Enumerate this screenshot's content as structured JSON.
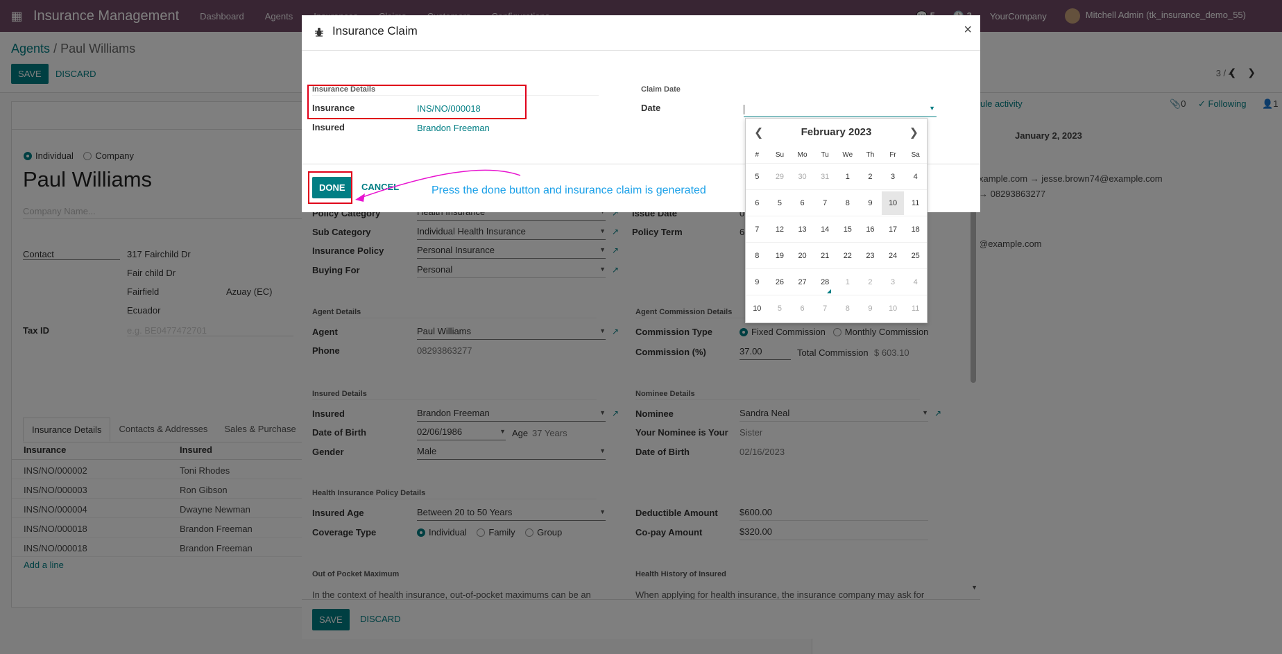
{
  "topbar": {
    "app_name": "Insurance Management",
    "menu": [
      "Dashboard",
      "Agents",
      "Insurances",
      "Claims",
      "Customers",
      "Configurations"
    ],
    "company": "YourCompany",
    "user": "Mitchell Admin (tk_insurance_demo_55)",
    "badge_messages": "5",
    "badge_activities": "3"
  },
  "control_panel": {
    "breadcrumb_parent": "Agents",
    "breadcrumb_sep": "/",
    "breadcrumb_current": "Paul Williams",
    "save": "SAVE",
    "discard": "DISCARD",
    "pager": "3 / 4"
  },
  "partner": {
    "type_individual": "Individual",
    "type_company": "Company",
    "name": "Paul Williams",
    "company_placeholder": "Company Name...",
    "address_type": "Contact",
    "street": "317 Fairchild Dr",
    "street2": "Fair child Dr",
    "city": "Fairfield",
    "state": "Azuay (EC)",
    "country": "Ecuador",
    "tax_id_label": "Tax ID",
    "tax_id_placeholder": "e.g. BE0477472701"
  },
  "notebook": {
    "tabs": [
      "Insurance Details",
      "Contacts & Addresses",
      "Sales & Purchase"
    ],
    "columns": [
      "Insurance",
      "Insured"
    ],
    "rows": [
      [
        "INS/NO/000002",
        "Toni Rhodes"
      ],
      [
        "INS/NO/000003",
        "Ron Gibson"
      ],
      [
        "INS/NO/000004",
        "Dwayne Newman"
      ],
      [
        "INS/NO/000018",
        "Brandon Freeman"
      ],
      [
        "INS/NO/000018",
        "Brandon Freeman"
      ]
    ],
    "add_line": "Add a line"
  },
  "chatter": {
    "schedule": "ule activity",
    "attachments": "0",
    "following": "Following",
    "followers": "1",
    "date_sep": "January 2, 2023",
    "line1": "xample.com → jesse.brown74@example.com",
    "line2": "→ 08293863277",
    "line3": "@example.com"
  },
  "form_back": {
    "policy_category_label": "Policy Category",
    "policy_category": "Health Insurance",
    "sub_category_label": "Sub Category",
    "sub_category": "Individual Health Insurance",
    "insurance_policy_label": "Insurance Policy",
    "insurance_policy": "Personal Insurance",
    "buying_for_label": "Buying For",
    "buying_for": "Personal",
    "issue_date_label": "Issue Date",
    "issue_date": "0",
    "policy_term_label": "Policy Term",
    "policy_term": "6",
    "agent_details": "Agent Details",
    "agent_label": "Agent",
    "agent": "Paul Williams",
    "phone_label": "Phone",
    "phone": "08293863277",
    "agent_commission_details": "Agent Commission Details",
    "commission_type_label": "Commission Type",
    "commission_fixed": "Fixed Commission",
    "commission_monthly": "Monthly Commission",
    "commission_pct_label": "Commission (%)",
    "commission_pct": "37.00",
    "total_commission_label": "Total Commission",
    "total_commission": "$ 603.10",
    "insured_details": "Insured Details",
    "insured_label": "Insured",
    "insured": "Brandon Freeman",
    "dob_label": "Date of Birth",
    "dob": "02/06/1986",
    "age_label": "Age",
    "age": "37 Years",
    "gender_label": "Gender",
    "gender": "Male",
    "nominee_details": "Nominee Details",
    "nominee_label": "Nominee",
    "nominee": "Sandra Neal",
    "nominee_rel_label": "Your Nominee is Your",
    "nominee_rel": "Sister",
    "nominee_dob_label": "Date of Birth",
    "nominee_dob": "02/16/2023",
    "health_policy_details": "Health Insurance Policy Details",
    "insured_age_label": "Insured Age",
    "insured_age": "Between 20 to 50 Years",
    "coverage_type_label": "Coverage Type",
    "coverage_individual": "Individual",
    "coverage_family": "Family",
    "coverage_group": "Group",
    "deductible_label": "Deductible Amount",
    "deductible": "$600.00",
    "copay_label": "Co-pay Amount",
    "copay": "$320.00",
    "oop_label": "Out of Pocket Maximum",
    "oop_text": "In the context of health insurance, out-of-pocket maximums can be an",
    "history_label": "Health History of Insured",
    "history_text": "When applying for health insurance, the insurance company may ask for",
    "save": "SAVE",
    "discard": "DISCARD"
  },
  "dialog": {
    "title": "Insurance Claim",
    "close": "×",
    "insurance_details": "Insurance Details",
    "insurance_label": "Insurance",
    "insurance": "INS/NO/000018",
    "insured_label": "Insured",
    "insured": "Brandon Freeman",
    "claim_date": "Claim Date",
    "date_label": "Date",
    "date_value": "",
    "done": "DONE",
    "cancel": "CANCEL",
    "annotation": "Press the done button and insurance claim is generated"
  },
  "datepicker": {
    "month": "February 2023",
    "headers": [
      "#",
      "Su",
      "Mo",
      "Tu",
      "We",
      "Th",
      "Fr",
      "Sa"
    ],
    "weeks": [
      [
        "5",
        "29",
        "30",
        "31",
        "1",
        "2",
        "3",
        "4"
      ],
      [
        "6",
        "5",
        "6",
        "7",
        "8",
        "9",
        "10",
        "11"
      ],
      [
        "7",
        "12",
        "13",
        "14",
        "15",
        "16",
        "17",
        "18"
      ],
      [
        "8",
        "19",
        "20",
        "21",
        "22",
        "23",
        "24",
        "25"
      ],
      [
        "9",
        "26",
        "27",
        "28",
        "1",
        "2",
        "3",
        "4"
      ],
      [
        "10",
        "5",
        "6",
        "7",
        "8",
        "9",
        "10",
        "11"
      ]
    ],
    "today": "10",
    "selected": "28"
  },
  "colors": {
    "brand": "#714b67",
    "accent": "#017e84",
    "highlight_box": "#e0001a",
    "annotation_text": "#1aa0e8",
    "annotation_arrow": "#e815d0"
  }
}
